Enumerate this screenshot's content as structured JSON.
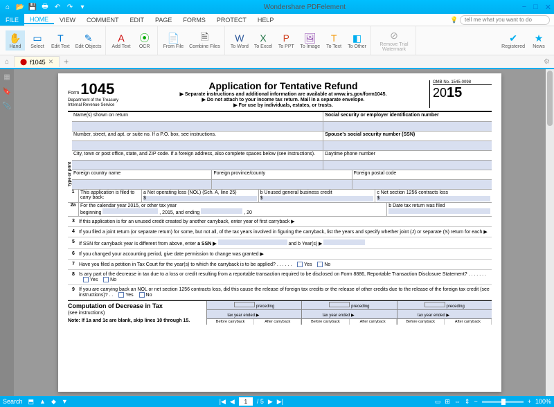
{
  "app": {
    "title": "Wondershare PDFelement"
  },
  "qat_icons": [
    "home",
    "open",
    "save",
    "print",
    "undo",
    "redo",
    "dropdown"
  ],
  "window_controls": {
    "min": "−",
    "max": "□",
    "close": "✕"
  },
  "menu": {
    "file": "FILE",
    "items": [
      "HOME",
      "VIEW",
      "COMMENT",
      "EDIT",
      "PAGE",
      "FORMS",
      "PROTECT",
      "HELP"
    ],
    "active_index": 0,
    "search_placeholder": "tell me what you want to do"
  },
  "ribbon": {
    "groups": [
      [
        {
          "label": "Hand",
          "active": true,
          "glyph": "✋"
        },
        {
          "label": "Select",
          "glyph": "▭"
        },
        {
          "label": "Edit Text",
          "glyph": "T"
        },
        {
          "label": "Edit Objects",
          "glyph": "✎"
        }
      ],
      [
        {
          "label": "Add Text",
          "glyph": "A"
        },
        {
          "label": "OCR",
          "glyph": "⦿"
        }
      ],
      [
        {
          "label": "From File",
          "glyph": "📄"
        },
        {
          "label": "Combine Files",
          "glyph": "🗎"
        }
      ],
      [
        {
          "label": "To Word",
          "glyph": "W"
        },
        {
          "label": "To Excel",
          "glyph": "X"
        },
        {
          "label": "To PPT",
          "glyph": "P"
        },
        {
          "label": "To Image",
          "glyph": "🖼"
        },
        {
          "label": "To Text",
          "glyph": "T"
        },
        {
          "label": "To Other",
          "glyph": "…"
        }
      ],
      [
        {
          "label": "Remove Trial Watermark",
          "glyph": "⊘",
          "disabled": true
        }
      ],
      [
        {
          "label": "Registered",
          "glyph": "✔"
        },
        {
          "label": "News",
          "glyph": "★"
        }
      ]
    ]
  },
  "tabs": {
    "items": [
      {
        "name": "f1045",
        "close": "✕"
      }
    ],
    "add": "+"
  },
  "form": {
    "form_label": "Form",
    "form_number": "1045",
    "dept": "Department of the Treasury\nInternal Revenue Service",
    "title": "Application for Tentative Refund",
    "sub1": "▶ Separate instructions and additional information are available at www.irs.gov/form1045.",
    "sub2": "▶ Do not attach to your income tax return. Mail in a separate envelope.",
    "sub3": "▶ For use by individuals, estates, or trusts.",
    "omb": "OMB No. 1545-0098",
    "year_prefix": "20",
    "year_suffix": "15",
    "type_or_print": "Type or print",
    "rows": {
      "name_label": "Name(s) shown on return",
      "ssn_label": "Social security or employer identification number",
      "addr_label": "Number, street, and apt. or suite no. If a P.O. box, see instructions.",
      "spouse_ssn": "Spouse's social security number (SSN)",
      "city_label": "City, town or post office, state, and ZIP code. If a foreign address, also complete spaces below (see instructions).",
      "daytime_phone": "Daytime phone number",
      "foreign_country": "Foreign country name",
      "foreign_province": "Foreign province/county",
      "foreign_postal": "Foreign postal code"
    },
    "line1": {
      "num": "1",
      "stem": "This application is filed to carry back:",
      "a": "a Net operating loss (NOL) (Sch. A, line 25)",
      "b": "b Unused general business credit",
      "c": "c Net section 1256 contracts loss",
      "dollar": "$"
    },
    "line2a": {
      "num": "2a",
      "text_a": "For the calendar year 2015, or other tax year",
      "text_b": "beginning",
      "text_c": ", 2015, and ending",
      "text_d": ", 20",
      "b_label": "b Date tax return was filed"
    },
    "q": [
      {
        "n": "3",
        "txt": "If this application is for an unused credit created by another carryback, enter year of first carryback ▶"
      },
      {
        "n": "4",
        "txt": "If you filed a joint return (or separate return) for some, but not all, of the tax years involved in figuring the carryback, list the years and specify whether joint (J) or separate (S) return for each ▶"
      },
      {
        "n": "5",
        "txt_a": "If SSN for carryback year is different from above, enter",
        "txt_b": "a SSN ▶",
        "txt_c": "and b Year(s) ▶"
      },
      {
        "n": "6",
        "txt": "If you changed your accounting period, give date permission to change was granted ▶"
      },
      {
        "n": "7",
        "txt": "Have you filed a petition in Tax Court for the year(s) to which the carryback is to be applied?",
        "yn": true
      },
      {
        "n": "8",
        "txt": "Is any part of the decrease in tax due to a loss or credit resulting from a reportable transaction required to be disclosed on Form 8886, Reportable Transaction Disclosure Statement?",
        "yn": true
      },
      {
        "n": "9",
        "txt": "If you are carrying back an NOL or net section 1256 contracts loss, did this cause the release of foreign tax credits  or the release of other credits due to the release of the foreign tax credit (see instructions)?",
        "yn": true
      }
    ],
    "yes": "Yes",
    "no": "No",
    "comp": {
      "title": "Computation of Decrease in Tax",
      "sub": "(see instructions)",
      "note": "Note: If 1a and 1c are blank, skip lines 10 through 15.",
      "col_top": "preceding",
      "col_mid": "tax year ended ▶",
      "before": "Before carryback",
      "after": "After carryback"
    }
  },
  "statusbar": {
    "search": "Search",
    "nav_icons": [
      "⬒",
      "▲",
      "◆",
      "▼"
    ],
    "first": "|◀",
    "prev": "◀",
    "page": "1",
    "total": "/ 5",
    "next": "▶",
    "last": "▶|",
    "view_icons": [
      "▭",
      "⊞",
      "⇔",
      "⇕"
    ],
    "zoom_minus": "−",
    "zoom_plus": "+",
    "zoom_pct": "100%"
  }
}
